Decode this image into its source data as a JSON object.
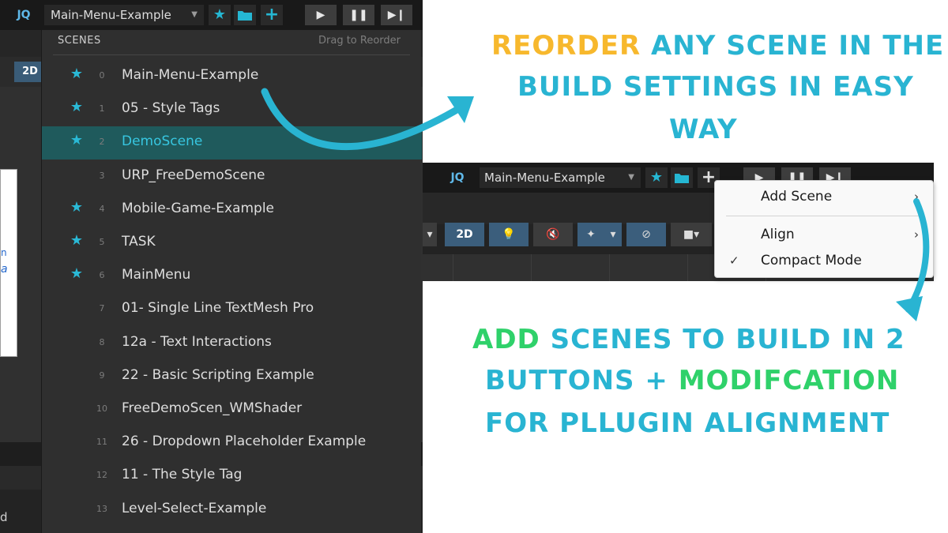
{
  "colors": {
    "accent_cyan": "#29b4d2",
    "accent_yellow": "#f7b82d",
    "accent_green": "#2fd16a",
    "editor_bg": "#232323",
    "selected_row": "#1f5a5c"
  },
  "toolbar": {
    "logo": "JQ",
    "current_scene": "Main-Menu-Example",
    "icons": [
      "star-icon",
      "folder-icon",
      "plus-icon"
    ],
    "playback": [
      "play-icon",
      "pause-icon",
      "step-icon"
    ]
  },
  "editor": {
    "mode_2d": "2D",
    "bottom_text": "d"
  },
  "dropdown": {
    "header": "SCENES",
    "hint": "Drag to Reorder",
    "scenes": [
      {
        "index": "0",
        "name": "Main-Menu-Example",
        "starred": true,
        "selected": false
      },
      {
        "index": "1",
        "name": "05 - Style Tags",
        "starred": true,
        "selected": false
      },
      {
        "index": "2",
        "name": "DemoScene",
        "starred": true,
        "selected": true
      },
      {
        "index": "3",
        "name": "URP_FreeDemoScene",
        "starred": false,
        "selected": false
      },
      {
        "index": "4",
        "name": "Mobile-Game-Example",
        "starred": true,
        "selected": false
      },
      {
        "index": "5",
        "name": "TASK",
        "starred": true,
        "selected": false
      },
      {
        "index": "6",
        "name": "MainMenu",
        "starred": true,
        "selected": false
      },
      {
        "index": "7",
        "name": "01-  Single Line TextMesh Pro",
        "starred": false,
        "selected": false
      },
      {
        "index": "8",
        "name": "12a - Text Interactions",
        "starred": false,
        "selected": false
      },
      {
        "index": "9",
        "name": "22 - Basic Scripting Example",
        "starred": false,
        "selected": false
      },
      {
        "index": "10",
        "name": "FreeDemoScen_WMShader",
        "starred": false,
        "selected": false
      },
      {
        "index": "11",
        "name": "26 - Dropdown Placeholder Example",
        "starred": false,
        "selected": false
      },
      {
        "index": "12",
        "name": "11 - The Style Tag",
        "starred": false,
        "selected": false
      },
      {
        "index": "13",
        "name": "Level-Select-Example",
        "starred": false,
        "selected": false
      }
    ]
  },
  "headline_top": {
    "line1_highlight": "Reorder",
    "line1_rest": "any scene in the",
    "line2": "build settings in easy",
    "line3": "way"
  },
  "headline_bottom": {
    "line1_highlight": "Add",
    "line1_rest": "scenes to build in 2",
    "line2_start": "buttons +",
    "line2_highlight": "modifcation",
    "line3": "for pllugin alignment"
  },
  "shot2": {
    "logo": "JQ",
    "current_scene": "Main-Menu-Example",
    "mode_2d": "2D"
  },
  "context_menu": {
    "items": [
      {
        "label": "Add Scene",
        "submenu": true,
        "checked": false
      },
      {
        "label": "Align",
        "submenu": true,
        "checked": false
      },
      {
        "label": "Compact Mode",
        "submenu": false,
        "checked": true
      }
    ]
  }
}
